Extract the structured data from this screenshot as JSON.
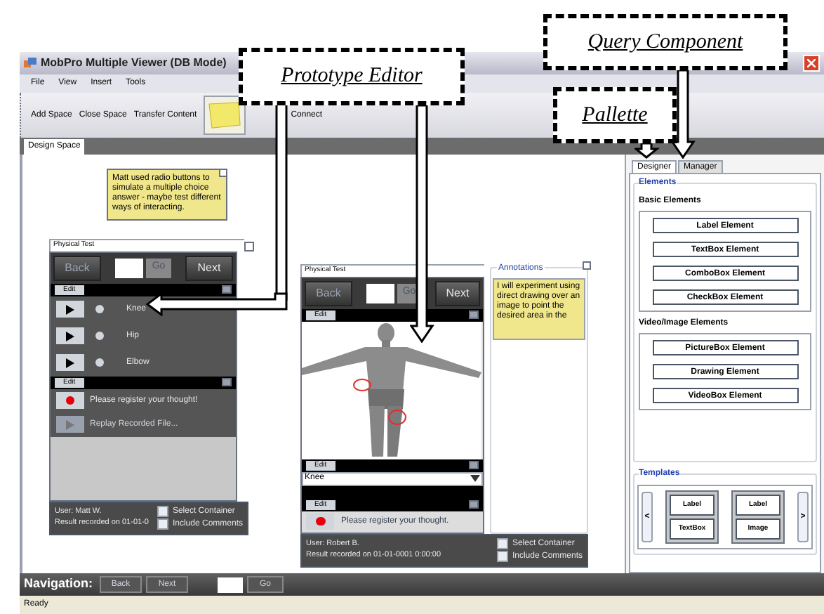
{
  "window": {
    "title": "MobPro Multiple Viewer (DB Mode)"
  },
  "menu": [
    "File",
    "View",
    "Insert",
    "Tools"
  ],
  "toolbar": [
    "Add Space",
    "Close Space",
    "Transfer Content",
    "Connect"
  ],
  "tabs": [
    {
      "label": "Design Space",
      "selected": true
    }
  ],
  "note": {
    "text": "Matt used radio buttons to simulate a multiple choice answer - maybe test different ways of interacting.",
    "checked": false
  },
  "form_1": {
    "title": "Physical Test",
    "checked": false,
    "back": "Back",
    "go": "Go",
    "next": "Next",
    "edits": [
      "Edit",
      "Edit"
    ],
    "options": [
      {
        "label": "Knee",
        "selected": false
      },
      {
        "label": "Hip",
        "selected": false
      },
      {
        "label": "Elbow",
        "selected": false
      }
    ],
    "record": "Please register your thought!",
    "replay": "Replay Recorded File...",
    "user": "User: Matt W.",
    "result": "Result recorded on 01-01-0",
    "checks": [
      {
        "label": "Select Container",
        "checked": false
      },
      {
        "label": "Include Comments",
        "checked": false
      }
    ]
  },
  "form_2": {
    "title": "Physical Test",
    "back": "Back",
    "go": "Go",
    "next": "Next",
    "edits": [
      "Edit",
      "Edit",
      "Edit"
    ],
    "select": "Knee",
    "record": "Please register your thought.",
    "user": "User: Robert B.",
    "result": "Result recorded on 01-01-0001 0:00:00",
    "checks": [
      {
        "label": "Select Container",
        "checked": false
      },
      {
        "label": "Include Comments",
        "checked": false
      }
    ]
  },
  "annotations": {
    "title": "Annotations",
    "checked": false,
    "text": "I will experiment using direct drawing over an image to point the desired area in the"
  },
  "palette": {
    "tabs": [
      {
        "label": "Designer",
        "selected": true
      },
      {
        "label": "Manager",
        "selected": false
      }
    ],
    "group": "Elements",
    "sections": [
      {
        "title": "Basic Elements",
        "items": [
          "Label Element",
          "TextBox Element",
          "ComboBox Element",
          "CheckBox Element"
        ]
      },
      {
        "title": "Video/Image Elements",
        "items": [
          "PictureBox Element",
          "Drawing Element",
          "VideoBox Element"
        ]
      }
    ],
    "templates": {
      "title": "Templates",
      "prev": "<",
      "next": ">",
      "cards": [
        [
          "Label",
          "TextBox"
        ],
        [
          "Label",
          "Image"
        ]
      ]
    }
  },
  "navigation": {
    "label": "Navigation:",
    "back": "Back",
    "next": "Next",
    "go": "Go"
  },
  "status_bar": "Ready",
  "callouts": [
    "Prototype Editor",
    "Query Component",
    "Pallette"
  ]
}
